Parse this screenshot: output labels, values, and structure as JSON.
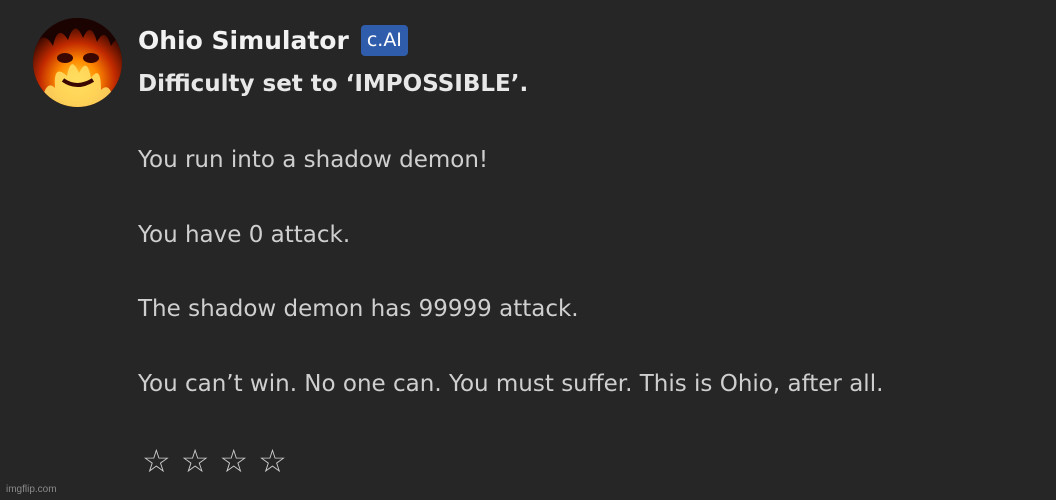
{
  "message": {
    "character_name": "Ohio Simulator",
    "badge": "c.AI",
    "lines": [
      "Difficulty set to ‘IMPOSSIBLE’.",
      "You run into a shadow demon!",
      "You have 0 attack.",
      "The shadow demon has 99999 attack.",
      "You can’t win. No one can. You must suffer. This is Ohio, after all."
    ]
  },
  "rating": {
    "stars": [
      "☆",
      "☆",
      "☆",
      "☆"
    ]
  },
  "watermark": "imgflip.com",
  "colors": {
    "background": "#262626",
    "badge": "#2f5dab",
    "text": "#cfcfcf"
  }
}
